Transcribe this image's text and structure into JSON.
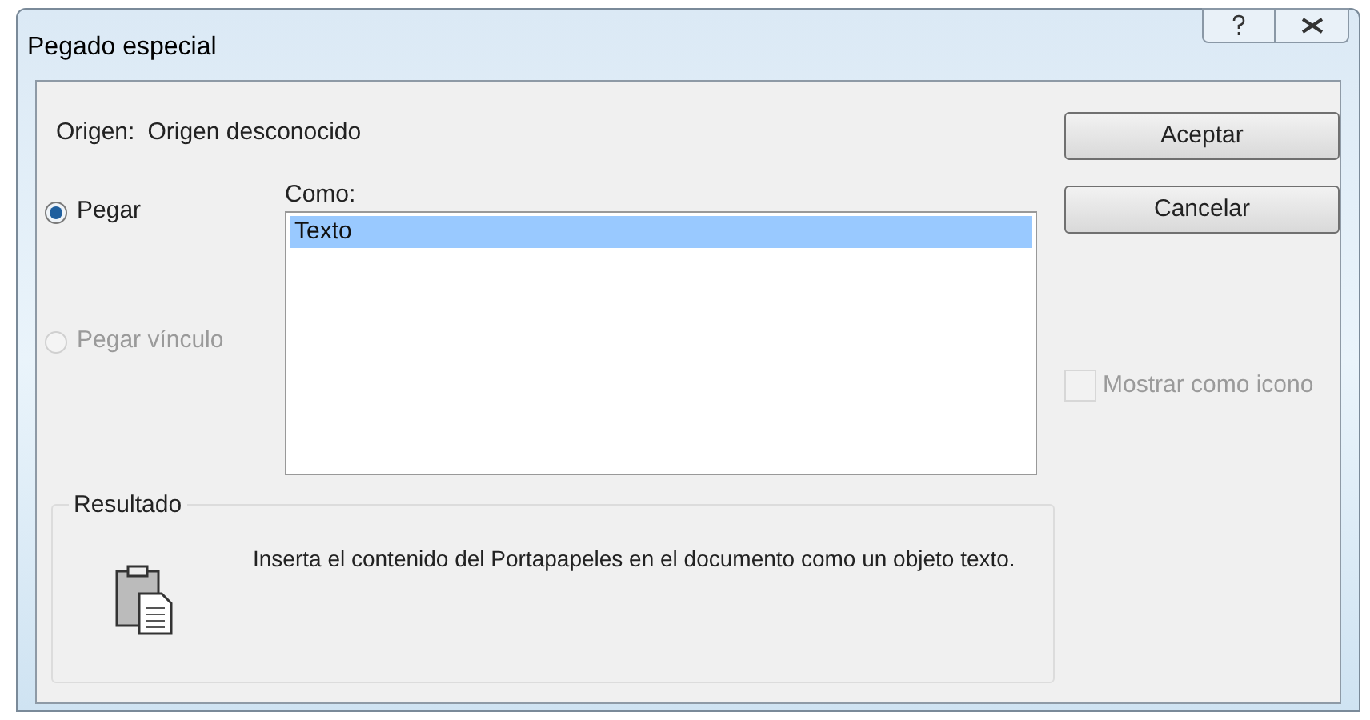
{
  "window": {
    "title": "Pegado especial"
  },
  "source": {
    "label": "Origen:",
    "value": "Origen desconocido"
  },
  "paste_options": [
    {
      "label": "Pegar",
      "selected": true,
      "disabled": false
    },
    {
      "label": "Pegar vínculo",
      "selected": false,
      "disabled": true
    }
  ],
  "as_list": {
    "label": "Como:",
    "items": [
      {
        "label": "Texto",
        "selected": true
      }
    ]
  },
  "buttons": [
    "Aceptar",
    "Cancelar"
  ],
  "display_as_icon": {
    "label": "Mostrar como icono",
    "checked": false,
    "disabled": true
  },
  "result": {
    "title": "Resultado",
    "description": "Inserta el contenido del Portapapeles en el documento como un objeto texto."
  }
}
